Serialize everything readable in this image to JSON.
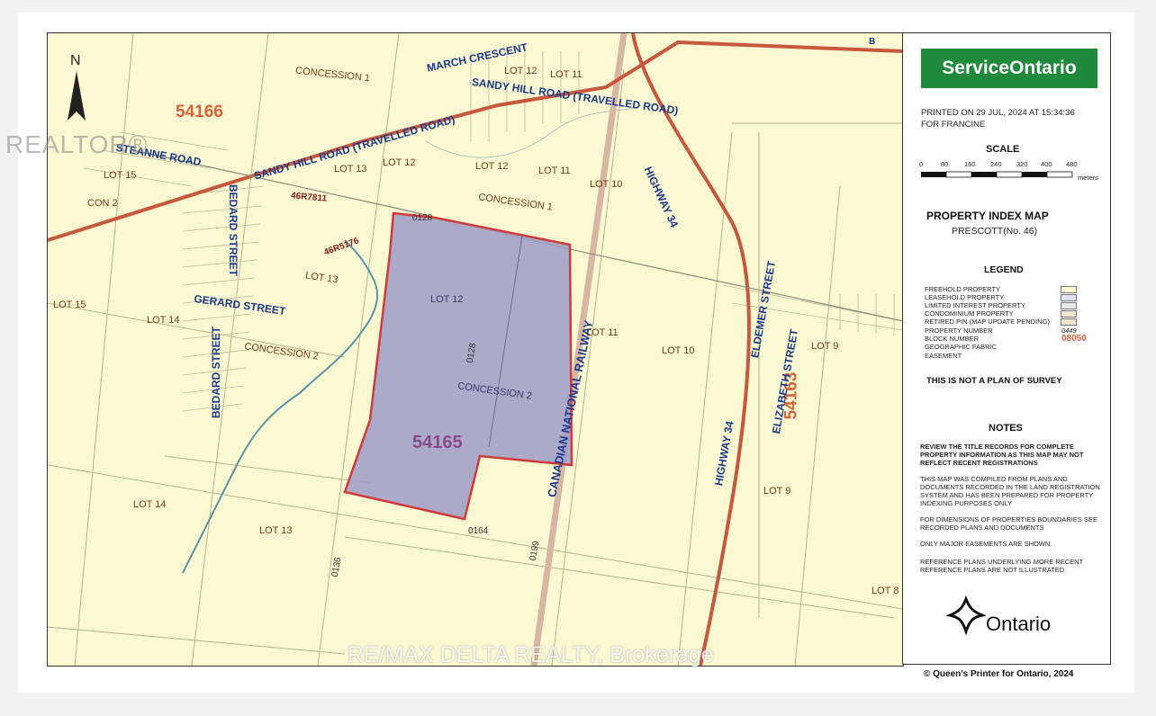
{
  "map": {
    "blocks": [
      "54166",
      "54165",
      "54163"
    ],
    "streets": [
      "MARCH CRESCENT",
      "SANDY HILL ROAD (TRAVELLED ROAD)",
      "SANDY HILL ROAD (TRAVELLED ROAD)",
      "STEANNE ROAD",
      "BEDARD STREET",
      "GERARD STREET",
      "HIGHWAY 34",
      "HIGHWAY 34",
      "ELDEMER STREET",
      "ELIZABETH STREET",
      "CANADIAN NATIONAL RAILWAY",
      "B"
    ],
    "lots": [
      "CONCESSION 1",
      "CONCESSION 1",
      "CONCESSION 2",
      "CONCESSION 2",
      "LOT 12",
      "LOT 11",
      "LOT 13",
      "LOT 12",
      "LOT 12",
      "LOT 11",
      "LOT 10",
      "LOT 15",
      "CON 2",
      "LOT 13",
      "LOT 15",
      "LOT 14",
      "LOT 12",
      "LOT 11",
      "LOT 10",
      "LOT 9",
      "LOT 14",
      "LOT 13",
      "LOT 9",
      "LOT 8"
    ],
    "plans": [
      "46R7811",
      "46R5176"
    ],
    "pins": [
      "0128",
      "0164",
      "0199",
      "0136",
      "0128"
    ],
    "watermark": "RE/MAX DELTA REALTY, Brokerage",
    "realtor_watermark": "REALTOR®",
    "north": "N",
    "colors": {
      "fabric": "#fbf8d2",
      "road": "#c7583e",
      "parcel": "#9c9cc8",
      "parcel_border": "#d23a3a",
      "creek": "#5b94a8"
    }
  },
  "panel": {
    "logo": "ServiceOntario",
    "printed": "PRINTED ON 29 JUL, 2024 AT 15:34:36",
    "printed_for": "FOR FRANCINE",
    "scale_title": "SCALE",
    "scale_ticks": [
      "0",
      "80",
      "160",
      "240",
      "320",
      "400",
      "480"
    ],
    "scale_unit": "meters",
    "title": "PROPERTY INDEX MAP",
    "subtitle": "PRESCOTT(No. 46)",
    "legend_title": "LEGEND",
    "legend": [
      "FREEHOLD PROPERTY",
      "LEASEHOLD PROPERTY",
      "LIMITED INTEREST PROPERTY",
      "CONDOMINIUM PROPERTY",
      "RETIRED PIN (MAP UPDATE PENDING)",
      "PROPERTY NUMBER",
      "BLOCK NUMBER",
      "GEOGRAPHIC FABRIC",
      "EASEMENT"
    ],
    "legend_property_number": "0449",
    "legend_block_number": "08050",
    "not_survey": "THIS IS NOT A PLAN OF SURVEY",
    "notes_title": "NOTES",
    "notes": [
      "REVIEW THE TITLE RECORDS FOR COMPLETE PROPERTY INFORMATION AS THIS MAP MAY NOT REFLECT RECENT REGISTRATIONS",
      "THIS MAP WAS COMPILED FROM PLANS AND DOCUMENTS RECORDED IN THE LAND REGISTRATION SYSTEM AND HAS BEEN PREPARED FOR PROPERTY INDEXING PURPOSES ONLY",
      "FOR DIMENSIONS OF PROPERTIES BOUNDARIES SEE RECORDED PLANS AND DOCUMENTS",
      "ONLY MAJOR EASEMENTS ARE SHOWN",
      "REFERENCE PLANS UNDERLYING MORE RECENT REFERENCE PLANS ARE NOT ILLUSTRATED"
    ],
    "ontario": "Ontario"
  },
  "copyright": "© Queen's Printer for Ontario, 2024"
}
